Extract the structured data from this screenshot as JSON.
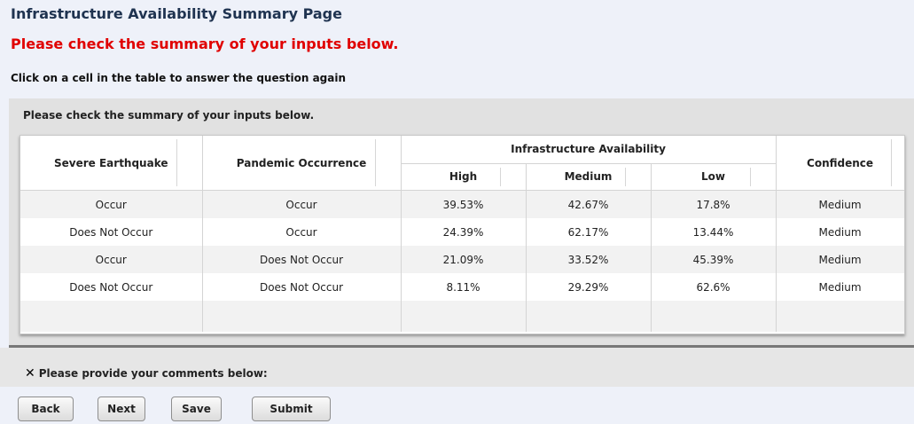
{
  "page": {
    "title": "Infrastructure Availability Summary Page",
    "notice": "Please check the summary of your inputs below.",
    "instruction": "Click on a cell in the table to answer the question again"
  },
  "panel": {
    "header": "Please check the summary of your inputs below."
  },
  "table": {
    "headers": {
      "col1": "Severe Earthquake",
      "col2": "Pandemic Occurrence",
      "group": "Infrastructure Availability",
      "high": "High",
      "medium": "Medium",
      "low": "Low",
      "confidence": "Confidence"
    },
    "rows": [
      {
        "earthquake": "Occur",
        "pandemic": "Occur",
        "high": "39.53%",
        "medium": "42.67%",
        "low": "17.8%",
        "confidence": "Medium"
      },
      {
        "earthquake": "Does Not Occur",
        "pandemic": "Occur",
        "high": "24.39%",
        "medium": "62.17%",
        "low": "13.44%",
        "confidence": "Medium"
      },
      {
        "earthquake": "Occur",
        "pandemic": "Does Not Occur",
        "high": "21.09%",
        "medium": "33.52%",
        "low": "45.39%",
        "confidence": "Medium"
      },
      {
        "earthquake": "Does Not Occur",
        "pandemic": "Does Not Occur",
        "high": "8.11%",
        "medium": "29.29%",
        "low": "62.6%",
        "confidence": "Medium"
      }
    ]
  },
  "comments": {
    "icon": "x-icon",
    "label": "Please provide your comments below:"
  },
  "buttons": {
    "back": "Back",
    "next": "Next",
    "save": "Save",
    "submit": "Submit"
  }
}
